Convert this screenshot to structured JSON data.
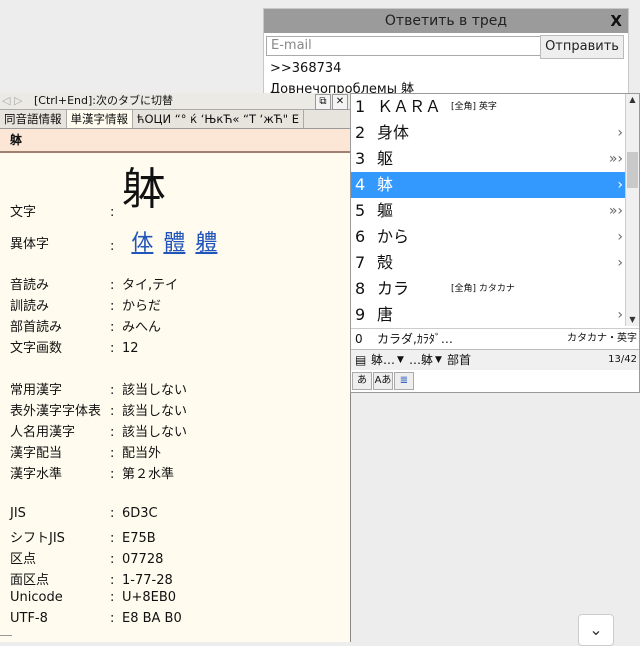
{
  "reply": {
    "title": "Ответить в тред",
    "close": "X",
    "email_placeholder": "E-mail",
    "send_label": "Отправить",
    "quote": ">>368734",
    "text": "Довнечопроблемы 躰"
  },
  "dict": {
    "hint": "[Ctrl+End]:次のタブに切替",
    "tabs": [
      "同音語情報",
      "単漢字情報",
      "ћОЦИ “° ќ ‘ЊкЋ« “Т ‘жЋ\" Е"
    ],
    "header": "躰",
    "kanji": "躰",
    "moji_label": "文字",
    "itaiji_label": "異体字",
    "variants": [
      "体",
      "體",
      "軆"
    ],
    "rows1": [
      {
        "k": "音読み",
        "v": "タイ,テイ"
      },
      {
        "k": "訓読み",
        "v": "からだ"
      },
      {
        "k": "部首読み",
        "v": "みへん"
      },
      {
        "k": "文字画数",
        "v": "12"
      }
    ],
    "rows2": [
      {
        "k": "常用漢字",
        "v": "該当しない"
      },
      {
        "k": "表外漢字字体表",
        "v": "該当しない"
      },
      {
        "k": "人名用漢字",
        "v": "該当しない"
      },
      {
        "k": "漢字配当",
        "v": "配当外"
      },
      {
        "k": "漢字水準",
        "v": "第２水準"
      }
    ],
    "rows3": [
      {
        "k": "JIS",
        "v": "6D3C"
      },
      {
        "k": "シフトJIS",
        "v": "E75B"
      },
      {
        "k": "区点",
        "v": "07728"
      },
      {
        "k": "面区点",
        "v": "1-77-28"
      },
      {
        "k": "Unicode",
        "v": "U+8EB0"
      },
      {
        "k": "UTF-8",
        "v": "E8 BA B0"
      }
    ]
  },
  "candidates": {
    "items": [
      {
        "num": "1",
        "word": "ＫＡＲＡ",
        "note": "[全角] 英字",
        "arrow": ""
      },
      {
        "num": "2",
        "word": "身体",
        "note": "",
        "arrow": "›"
      },
      {
        "num": "3",
        "word": "躯",
        "note": "",
        "arrow": "»›"
      },
      {
        "num": "4",
        "word": "躰",
        "note": "",
        "arrow": "›"
      },
      {
        "num": "5",
        "word": "軀",
        "note": "",
        "arrow": "»›"
      },
      {
        "num": "6",
        "word": "から",
        "note": "",
        "arrow": "›"
      },
      {
        "num": "7",
        "word": "殻",
        "note": "",
        "arrow": "›"
      },
      {
        "num": "8",
        "word": "カラ",
        "note": "[全角] カタカナ",
        "arrow": ""
      },
      {
        "num": "9",
        "word": "唐",
        "note": "",
        "arrow": "›"
      }
    ],
    "preview_num": "0",
    "preview_text": "カラダ,ｶﾗﾀﾞ…",
    "preview_type": "カタカナ・英字",
    "status_seg1": "躰…",
    "status_seg2": "…躰",
    "status_seg3": "部首",
    "count": "13/42",
    "modes": [
      "あ",
      "Aあ",
      "≣"
    ]
  }
}
